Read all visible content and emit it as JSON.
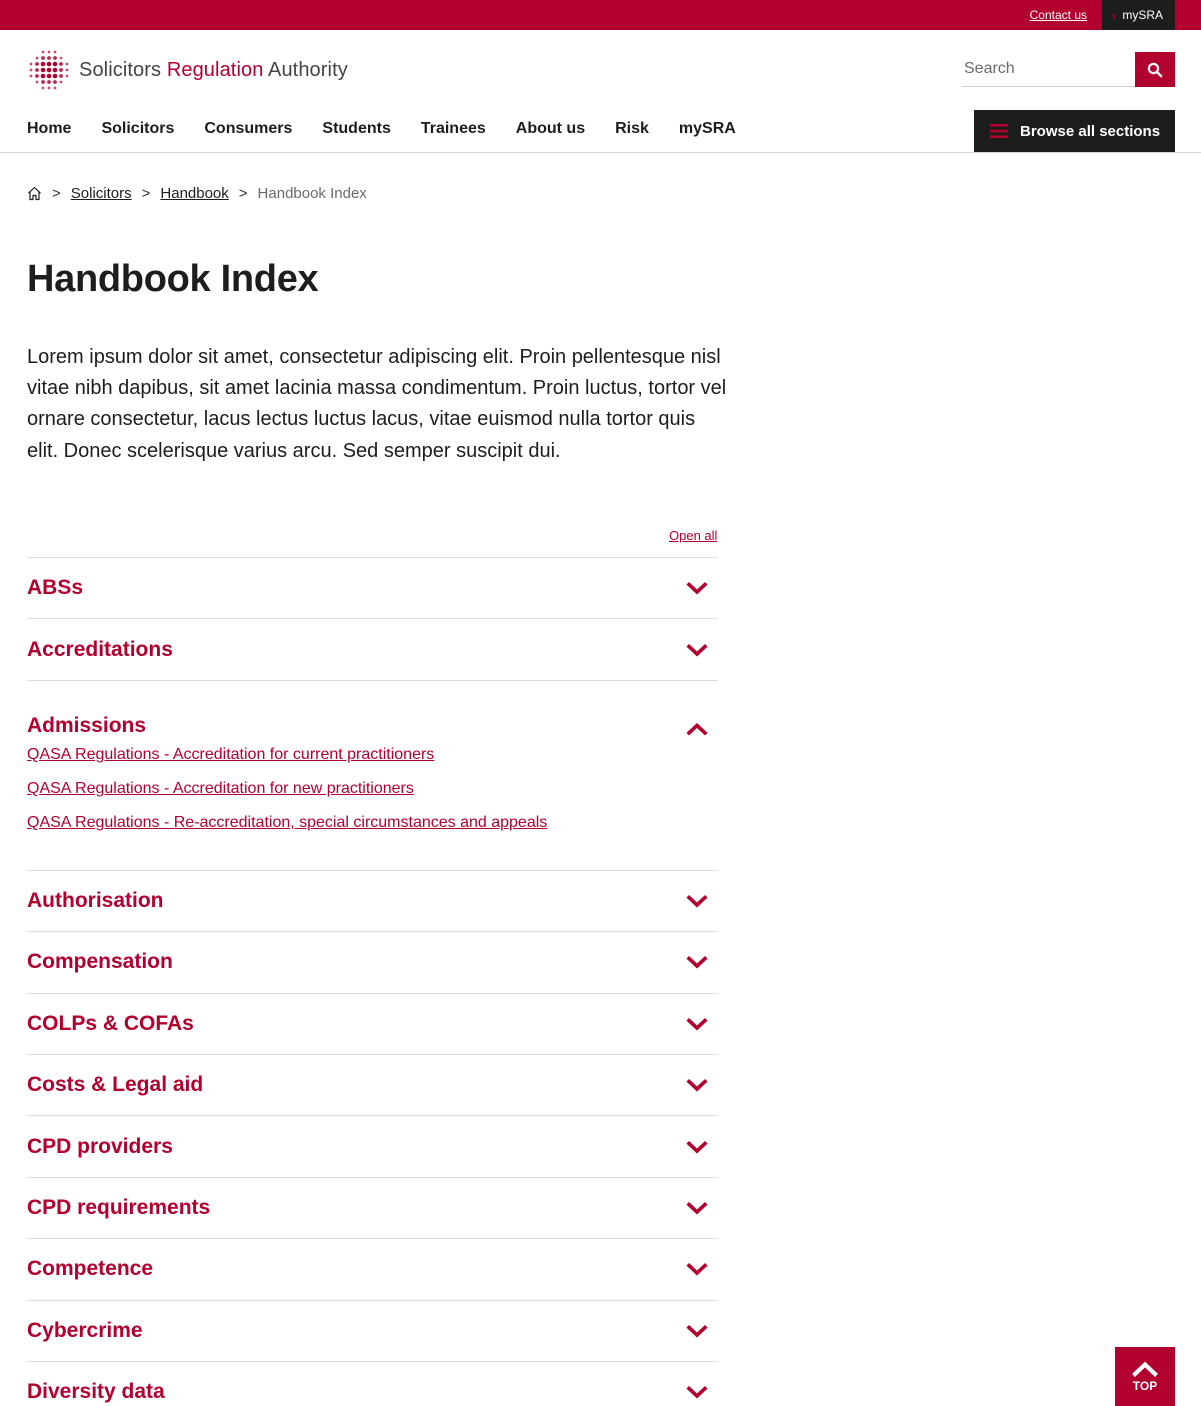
{
  "utility": {
    "contact_label": "Contact us",
    "mysra_label": "mySRA"
  },
  "header": {
    "logo_part1": "Solicitors",
    "logo_part2": "Regulation",
    "logo_part3": "Authority",
    "search_placeholder": "Search"
  },
  "nav": {
    "items": [
      "Home",
      "Solicitors",
      "Consumers",
      "Students",
      "Trainees",
      "About us",
      "Risk",
      "mySRA"
    ],
    "browse_label": "Browse all sections"
  },
  "breadcrumb": {
    "items": [
      "Solicitors",
      "Handbook"
    ],
    "current": "Handbook Index"
  },
  "page": {
    "title": "Handbook Index",
    "intro": "Lorem ipsum dolor sit amet, consectetur adipiscing elit. Proin pellentesque nisl vitae nibh dapibus, sit amet lacinia massa condimentum. Proin luctus, tortor vel ornare consectetur, lacus lectus luctus lacus, vitae euismod nulla tortor quis elit. Donec scelerisque varius arcu. Sed semper suscipit dui.",
    "open_all_label": "Open all"
  },
  "accordion": [
    {
      "title": "ABSs",
      "open": false
    },
    {
      "title": "Accreditations",
      "open": false
    },
    {
      "title": "Admissions",
      "open": true,
      "links": [
        "QASA Regulations - Accreditation for current practitioners",
        "QASA Regulations - Accreditation for new practitioners",
        "QASA Regulations - Re-accreditation, special circumstances and appeals"
      ]
    },
    {
      "title": "Authorisation",
      "open": false
    },
    {
      "title": "Compensation",
      "open": false
    },
    {
      "title": "COLPs & COFAs",
      "open": false
    },
    {
      "title": "Costs & Legal aid",
      "open": false
    },
    {
      "title": "CPD providers",
      "open": false
    },
    {
      "title": "CPD requirements",
      "open": false
    },
    {
      "title": "Competence",
      "open": false
    },
    {
      "title": "Cybercrime",
      "open": false
    },
    {
      "title": "Diversity data",
      "open": false
    }
  ],
  "back_to_top_label": "TOP",
  "colors": {
    "brand": "#b2002f",
    "dark": "#1d1d1b"
  },
  "icons": [
    "home-icon",
    "search-icon",
    "menu-icon",
    "chevron-down-icon",
    "chevron-up-icon",
    "chevron-right-icon"
  ]
}
